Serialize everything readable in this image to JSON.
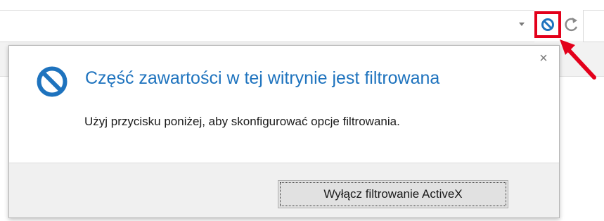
{
  "colors": {
    "accent_blue": "#1e73be",
    "highlight_red": "#e3001b"
  },
  "toolbar": {
    "dropdown_icon": "chevron-down-icon",
    "filter_icon": "blocked-icon",
    "refresh_icon": "refresh-icon"
  },
  "popup": {
    "close_label": "×",
    "title": "Część zawartości w tej witrynie jest filtrowana",
    "body": "Użyj przycisku poniżej, aby skonfigurować opcje filtrowania.",
    "button_label": "Wyłącz filtrowanie ActiveX",
    "icon": "blocked-icon"
  }
}
